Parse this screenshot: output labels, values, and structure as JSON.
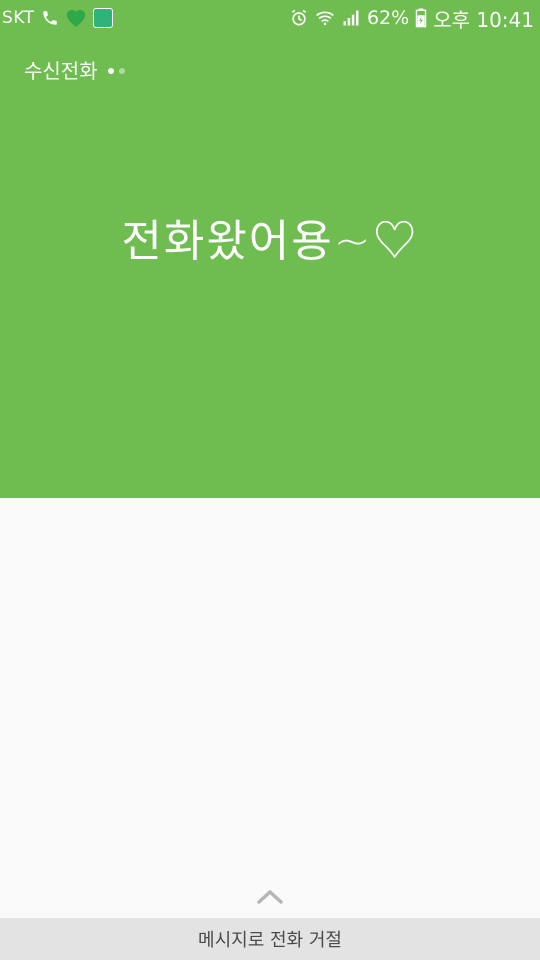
{
  "status_bar": {
    "carrier": "SKT",
    "battery": "62%",
    "time": "오후 10:41",
    "icons": [
      "phone-icon",
      "heart-icon",
      "app-icon",
      "alarm-icon",
      "wifi-icon",
      "signal-icon",
      "battery-icon"
    ]
  },
  "call": {
    "label": "수신전화",
    "caller_name": "전화왔어용~♡"
  },
  "reject_message": {
    "label": "메시지로 전화 거절"
  },
  "colors": {
    "accent": "#6fbd51",
    "background": "#fafafa",
    "bottom_bar": "#e3e3e3"
  }
}
